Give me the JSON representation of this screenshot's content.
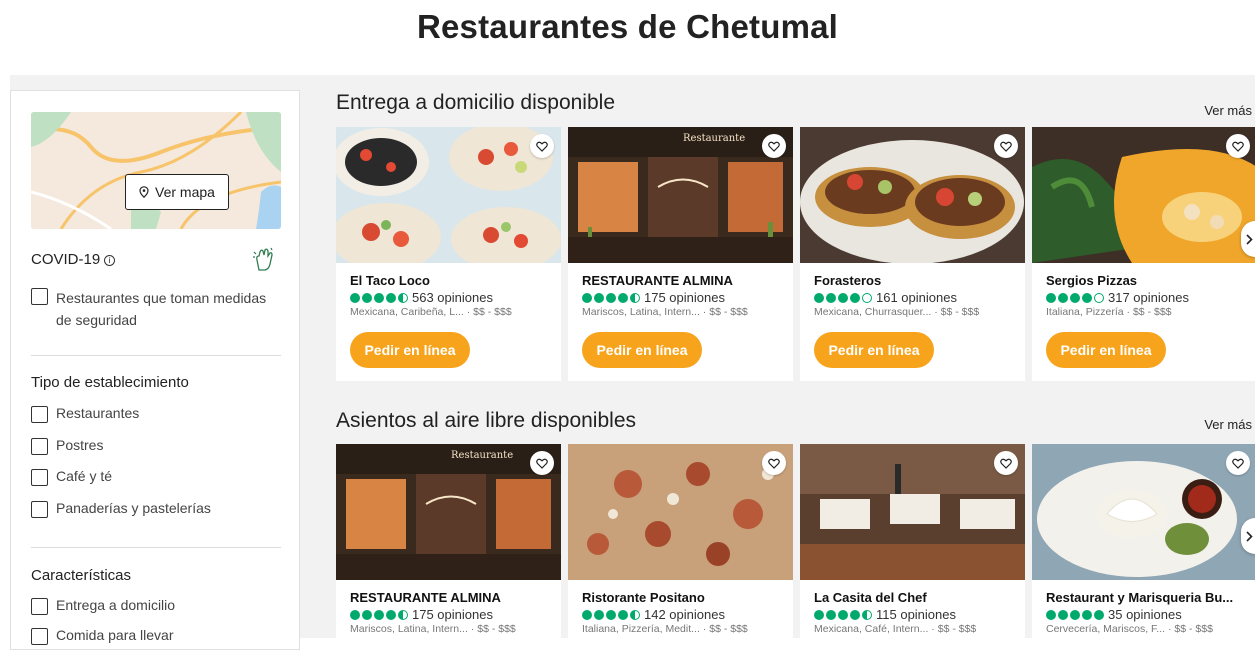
{
  "page": {
    "title": "Restaurantes de Chetumal"
  },
  "sidebar": {
    "map_button_label": "Ver mapa",
    "covid": {
      "title": "COVID-19",
      "option": "Restaurantes que toman medidas de seguridad"
    },
    "establishment": {
      "title": "Tipo de establecimiento",
      "options": [
        "Restaurantes",
        "Postres",
        "Café y té",
        "Panaderías y pastelerías"
      ]
    },
    "features": {
      "title": "Características",
      "options": [
        "Entrega a domicilio",
        "Comida para llevar"
      ]
    }
  },
  "rows": [
    {
      "title": "Entrega a domicilio disponible",
      "see_more": "Ver más",
      "cards": [
        {
          "name": "El Taco Loco",
          "rating": 4.5,
          "reviews": "563 opiniones",
          "cuisine": "Mexicana, Caribeña, L...",
          "price": "$$ - $$$",
          "button": "Pedir en línea"
        },
        {
          "name": "RESTAURANTE ALMINA",
          "rating": 4.5,
          "reviews": "175 opiniones",
          "cuisine": "Mariscos, Latina, Intern...",
          "price": "$$ - $$$",
          "button": "Pedir en línea"
        },
        {
          "name": "Forasteros",
          "rating": 4,
          "reviews": "161 opiniones",
          "cuisine": "Mexicana, Churrasquer...",
          "price": "$$ - $$$",
          "button": "Pedir en línea"
        },
        {
          "name": "Sergios Pizzas",
          "rating": 4,
          "reviews": "317 opiniones",
          "cuisine": "Italiana, Pizzería",
          "price": "$$ - $$$",
          "button": "Pedir en línea"
        }
      ]
    },
    {
      "title": "Asientos al aire libre disponibles",
      "see_more": "Ver más",
      "cards": [
        {
          "name": "RESTAURANTE ALMINA",
          "rating": 4.5,
          "reviews": "175 opiniones",
          "cuisine": "Mariscos, Latina, Intern...",
          "price": "$$ - $$$"
        },
        {
          "name": "Ristorante Positano",
          "rating": 4.5,
          "reviews": "142 opiniones",
          "cuisine": "Italiana, Pizzería, Medit...",
          "price": "$$ - $$$"
        },
        {
          "name": "La Casita del Chef",
          "rating": 4.5,
          "reviews": "115 opiniones",
          "cuisine": "Mexicana, Café, Intern...",
          "price": "$$ - $$$"
        },
        {
          "name": "Restaurant y Marisqueria Bu...",
          "rating": 5,
          "reviews": "35 opiniones",
          "cuisine": "Cervecería, Mariscos, F...",
          "price": "$$ - $$$"
        }
      ]
    }
  ],
  "colors": {
    "accent_button": "#f8a31c",
    "rating_green": "#00aa6c",
    "background": "#f2f2f2"
  },
  "icons": [
    "map-pin-icon",
    "info-icon",
    "hand-sanitizer-icon",
    "heart-icon",
    "chevron-right-icon",
    "rating-bubble-icon"
  ]
}
